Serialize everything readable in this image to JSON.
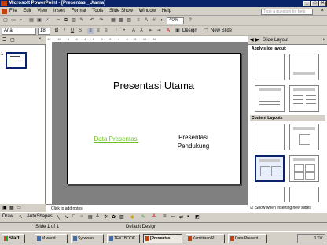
{
  "window": {
    "title": "Microsoft PowerPoint - [Presentasi_Utama]"
  },
  "menubar": {
    "items": [
      "File",
      "Edit",
      "View",
      "Insert",
      "Format",
      "Tools",
      "Slide Show",
      "Window",
      "Help"
    ],
    "help_placeholder": "Type a question for help"
  },
  "toolbar": {
    "zoom": "40%",
    "font": "Arial",
    "font_size": "18",
    "bold": "B",
    "italic": "I",
    "underline": "U",
    "shadow": "S",
    "font_increase": "A",
    "font_decrease": "A",
    "design_label": "Design",
    "new_slide_label": "New Slide"
  },
  "outline": {
    "slide_number": "1"
  },
  "slide": {
    "title": "Presentasi Utama",
    "left_text": "Data Presentasi",
    "right_text": [
      "Presentasi",
      "Pendukung"
    ]
  },
  "notes": {
    "placeholder": "Click to add notes"
  },
  "taskpane": {
    "title": "Slide Layout",
    "section_apply": "Apply slide layout:",
    "section_content": "Content Layouts",
    "checkbox_label": "Show when inserting new slides"
  },
  "drawbar": {
    "draw_label": "Draw",
    "autoshapes_label": "AutoShapes"
  },
  "statusbar": {
    "slide_info": "Slide 1 of 1",
    "design": "Default Design"
  },
  "taskbar": {
    "start": "Start",
    "buttons": [
      "M.world",
      "Syoonan",
      "TEXTBOOK",
      "[Presentasi...",
      "Kemitraan P...",
      "Data Present..."
    ],
    "clock": "1:07"
  },
  "colors": {
    "titlebar": "#0a246a",
    "slide_left_text": "#6bbf1f",
    "accent": "#c2410c"
  }
}
